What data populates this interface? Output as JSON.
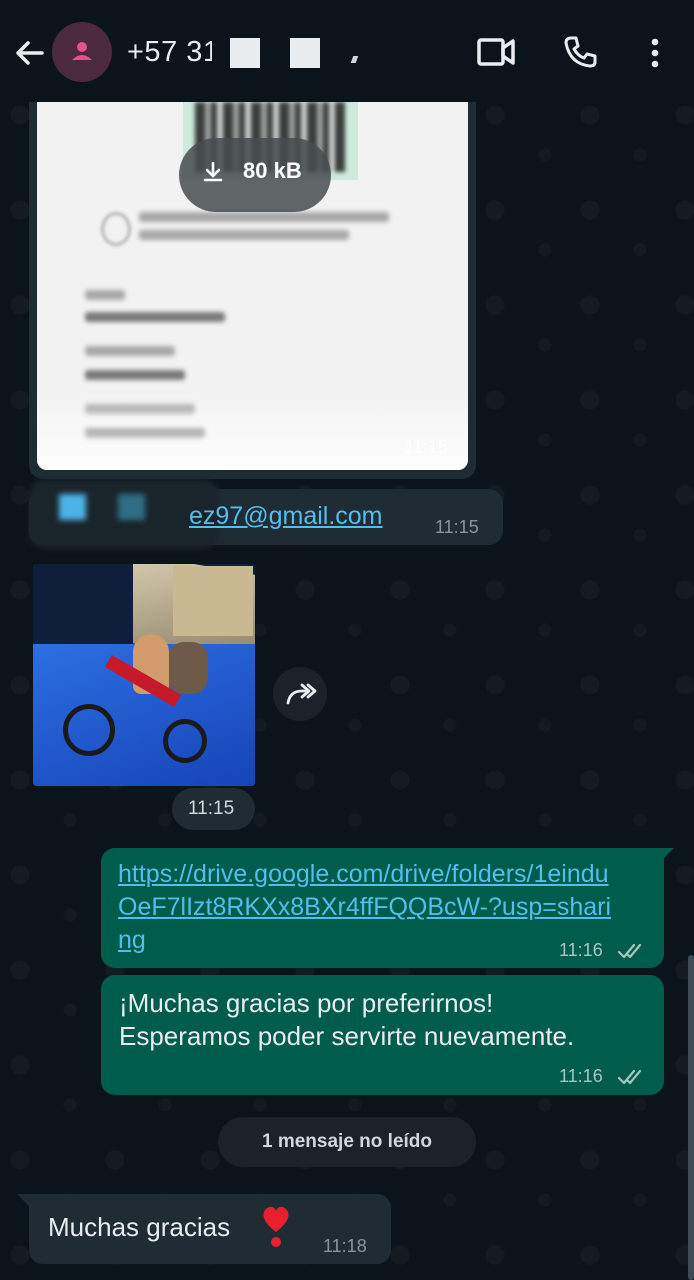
{
  "header": {
    "contact_name": "+57 3",
    "contact_name_partial": "1",
    "icons": [
      "back-arrow-icon",
      "user-icon",
      "video-call-icon",
      "phone-icon",
      "more-vert-icon"
    ]
  },
  "messages": {
    "doc_image": {
      "download_size": "80 kB",
      "time": "11:15"
    },
    "email": {
      "link": "ez97@gmail.com",
      "time": "11:15"
    },
    "video": {
      "time": "11:15"
    },
    "outgoing_link": {
      "text": "https://drive.google.com/drive/folders/1einduOeF7lIzt8RKXx8BXr4ffFQQBcW-?usp=sharing",
      "time": "11:16"
    },
    "outgoing_thanks": {
      "line1": "¡Muchas gracias por preferirnos!",
      "line2": "Esperamos poder servirte nuevamente.",
      "time": "11:16"
    },
    "unread_divider": "1 mensaje no leído",
    "incoming_last": {
      "text": "Muchas gracias",
      "emoji": "❣️",
      "time": "11:18"
    }
  },
  "colors": {
    "background": "#0b141a",
    "incoming_bubble": "#1f2c34",
    "outgoing_bubble": "#005c4b",
    "link": "#53bdeb",
    "read_ticks": "#8696a0"
  }
}
